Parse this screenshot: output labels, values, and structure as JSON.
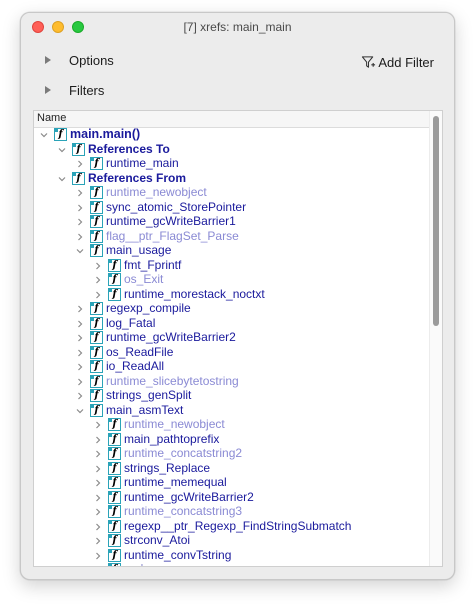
{
  "window": {
    "title": "[7] xrefs: main_main"
  },
  "sections": {
    "options": "Options",
    "filters": "Filters",
    "add_filter": "Add Filter"
  },
  "table": {
    "column": "Name"
  },
  "tree": [
    {
      "label": "main.main()",
      "depth": 0,
      "arrow": "open",
      "style": "root",
      "icon": true
    },
    {
      "label": "References To",
      "depth": 1,
      "arrow": "open",
      "style": "hdr",
      "icon": true
    },
    {
      "label": "runtime_main",
      "depth": 2,
      "arrow": "closed",
      "style": "normal",
      "icon": true
    },
    {
      "label": "References From",
      "depth": 1,
      "arrow": "open",
      "style": "hdr",
      "icon": true
    },
    {
      "label": "runtime_newobject",
      "depth": 2,
      "arrow": "closed",
      "style": "lib",
      "icon": true
    },
    {
      "label": "sync_atomic_StorePointer",
      "depth": 2,
      "arrow": "closed",
      "style": "normal",
      "icon": true
    },
    {
      "label": "runtime_gcWriteBarrier1",
      "depth": 2,
      "arrow": "closed",
      "style": "normal",
      "icon": true
    },
    {
      "label": "flag__ptr_FlagSet_Parse",
      "depth": 2,
      "arrow": "closed",
      "style": "lib",
      "icon": true
    },
    {
      "label": "main_usage",
      "depth": 2,
      "arrow": "open",
      "style": "normal",
      "icon": true
    },
    {
      "label": "fmt_Fprintf",
      "depth": 3,
      "arrow": "closed",
      "style": "normal",
      "icon": true
    },
    {
      "label": "os_Exit",
      "depth": 3,
      "arrow": "closed",
      "style": "lib",
      "icon": true
    },
    {
      "label": "runtime_morestack_noctxt",
      "depth": 3,
      "arrow": "closed",
      "style": "normal",
      "icon": true
    },
    {
      "label": "regexp_compile",
      "depth": 2,
      "arrow": "closed",
      "style": "normal",
      "icon": true
    },
    {
      "label": "log_Fatal",
      "depth": 2,
      "arrow": "closed",
      "style": "normal",
      "icon": true
    },
    {
      "label": "runtime_gcWriteBarrier2",
      "depth": 2,
      "arrow": "closed",
      "style": "normal",
      "icon": true
    },
    {
      "label": "os_ReadFile",
      "depth": 2,
      "arrow": "closed",
      "style": "normal",
      "icon": true
    },
    {
      "label": "io_ReadAll",
      "depth": 2,
      "arrow": "closed",
      "style": "normal",
      "icon": true
    },
    {
      "label": "runtime_slicebytetostring",
      "depth": 2,
      "arrow": "closed",
      "style": "lib",
      "icon": true
    },
    {
      "label": "strings_genSplit",
      "depth": 2,
      "arrow": "closed",
      "style": "normal",
      "icon": true
    },
    {
      "label": "main_asmText",
      "depth": 2,
      "arrow": "open",
      "style": "normal",
      "icon": true
    },
    {
      "label": "runtime_newobject",
      "depth": 3,
      "arrow": "closed",
      "style": "lib",
      "icon": true
    },
    {
      "label": "main_pathtoprefix",
      "depth": 3,
      "arrow": "closed",
      "style": "normal",
      "icon": true
    },
    {
      "label": "runtime_concatstring2",
      "depth": 3,
      "arrow": "closed",
      "style": "lib",
      "icon": true
    },
    {
      "label": "strings_Replace",
      "depth": 3,
      "arrow": "closed",
      "style": "normal",
      "icon": true
    },
    {
      "label": "runtime_memequal",
      "depth": 3,
      "arrow": "closed",
      "style": "normal",
      "icon": true
    },
    {
      "label": "runtime_gcWriteBarrier2",
      "depth": 3,
      "arrow": "closed",
      "style": "normal",
      "icon": true
    },
    {
      "label": "runtime_concatstring3",
      "depth": 3,
      "arrow": "closed",
      "style": "lib",
      "icon": true
    },
    {
      "label": "regexp__ptr_Regexp_FindStringSubmatch",
      "depth": 3,
      "arrow": "closed",
      "style": "normal",
      "icon": true
    },
    {
      "label": "strconv_Atoi",
      "depth": 3,
      "arrow": "closed",
      "style": "normal",
      "icon": true
    },
    {
      "label": "runtime_convTstring",
      "depth": 3,
      "arrow": "closed",
      "style": "normal",
      "icon": true
    },
    {
      "label": "main_warn",
      "depth": 3,
      "arrow": "closed",
      "style": "normal",
      "icon": true
    }
  ],
  "colors": {
    "link": "#1a1a9c",
    "library": "#8a8ad4",
    "icon_border": "#2aa3b8"
  }
}
